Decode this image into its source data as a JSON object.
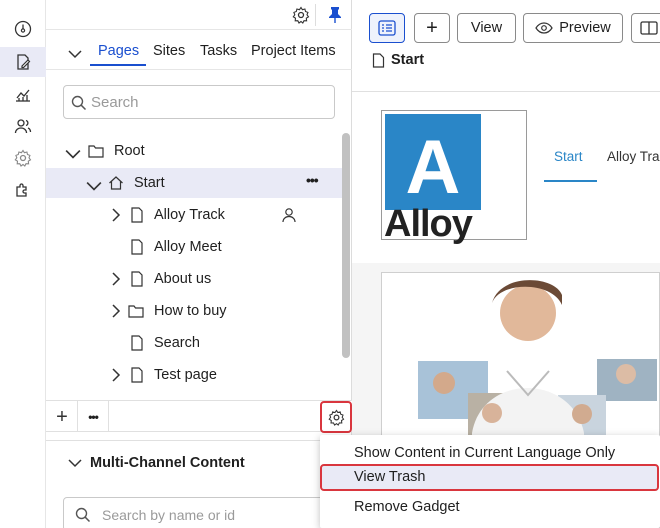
{
  "rail": {
    "items": [
      {
        "name": "dashboard-icon",
        "active": false
      },
      {
        "name": "edit-pages-icon",
        "active": true
      },
      {
        "name": "reports-icon",
        "active": false
      },
      {
        "name": "users-icon",
        "active": false
      },
      {
        "name": "settings-icon",
        "active": false
      },
      {
        "name": "addons-icon",
        "active": false
      }
    ]
  },
  "nav": {
    "tabs": [
      {
        "label": "Pages",
        "active": true
      },
      {
        "label": "Sites",
        "active": false
      },
      {
        "label": "Tasks",
        "active": false
      },
      {
        "label": "Project Items",
        "active": false
      }
    ],
    "search_placeholder": "Search",
    "tree": [
      {
        "label": "Root",
        "expanded": true
      },
      {
        "label": "Start",
        "selected": true,
        "more": "•••"
      },
      {
        "label": "Alloy Track"
      },
      {
        "label": "Alloy Meet"
      },
      {
        "label": "About us"
      },
      {
        "label": "How to buy"
      },
      {
        "label": "Search"
      },
      {
        "label": "Test page"
      }
    ],
    "bottombar": {
      "add": "+",
      "more": "•••"
    }
  },
  "mcc": {
    "title": "Multi-Channel Content",
    "search_placeholder": "Search by name or id"
  },
  "content": {
    "toolbar": {
      "view_label": "View",
      "preview_label": "Preview",
      "add": "+"
    },
    "page_title": "Start",
    "logo_letter": "A",
    "logo_text": "Alloy",
    "site_nav": [
      "Start",
      "Alloy Tra"
    ]
  },
  "context_menu": {
    "items": [
      {
        "label": "Show Content in Current Language Only"
      },
      {
        "label": "View Trash",
        "highlighted": true
      },
      {
        "label": "Remove Gadget"
      }
    ]
  }
}
